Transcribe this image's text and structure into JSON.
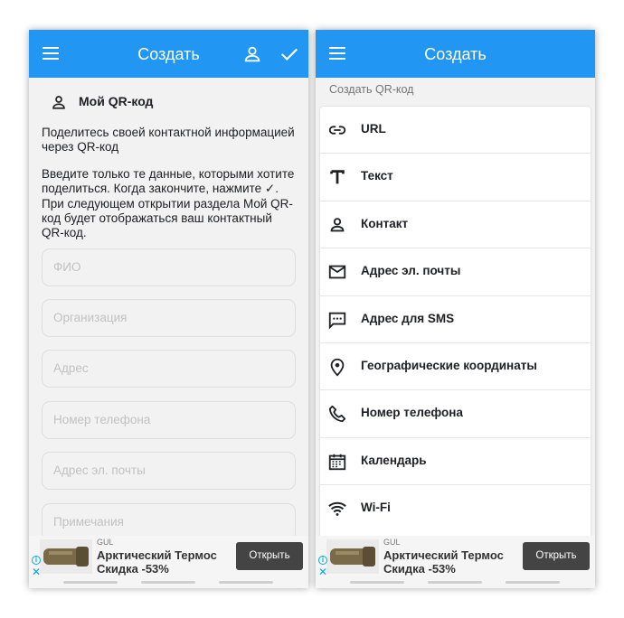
{
  "left": {
    "appbar": {
      "title": "Создать"
    },
    "my_qr_label": "Мой QR-код",
    "intro_text": "Поделитесь своей контактной информацией через QR-код",
    "instructions_text": "Введите только те данные, которыми хотите поделиться. Когда закончите, нажмите ✓. При следующем открытии раздела Мой QR-код будет отображаться ваш контактный QR-код.",
    "fields": [
      {
        "placeholder": "ФИО"
      },
      {
        "placeholder": "Организация"
      },
      {
        "placeholder": "Адрес"
      },
      {
        "placeholder": "Номер телефона"
      },
      {
        "placeholder": "Адрес эл. почты"
      },
      {
        "placeholder": "Примечания"
      }
    ]
  },
  "right": {
    "appbar": {
      "title": "Создать"
    },
    "section_label": "Создать QR-код",
    "items": [
      {
        "label": "URL",
        "icon": "link-icon"
      },
      {
        "label": "Текст",
        "icon": "text-icon"
      },
      {
        "label": "Контакт",
        "icon": "person-icon"
      },
      {
        "label": "Адрес эл. почты",
        "icon": "mail-icon"
      },
      {
        "label": "Адрес для SMS",
        "icon": "sms-icon"
      },
      {
        "label": "Географические координаты",
        "icon": "location-icon"
      },
      {
        "label": "Номер телефона",
        "icon": "phone-icon"
      },
      {
        "label": "Календарь",
        "icon": "calendar-icon"
      },
      {
        "label": "Wi-Fi",
        "icon": "wifi-icon"
      }
    ]
  },
  "ad": {
    "brand": "GUL",
    "line1": "Арктический Термос",
    "line2": "Скидка -53%",
    "button": "Открыть",
    "info_glyph": "i",
    "close_glyph": "✕"
  },
  "colors": {
    "primary": "#2196f3",
    "background": "#f2f2f2",
    "ad_button": "#444444"
  }
}
